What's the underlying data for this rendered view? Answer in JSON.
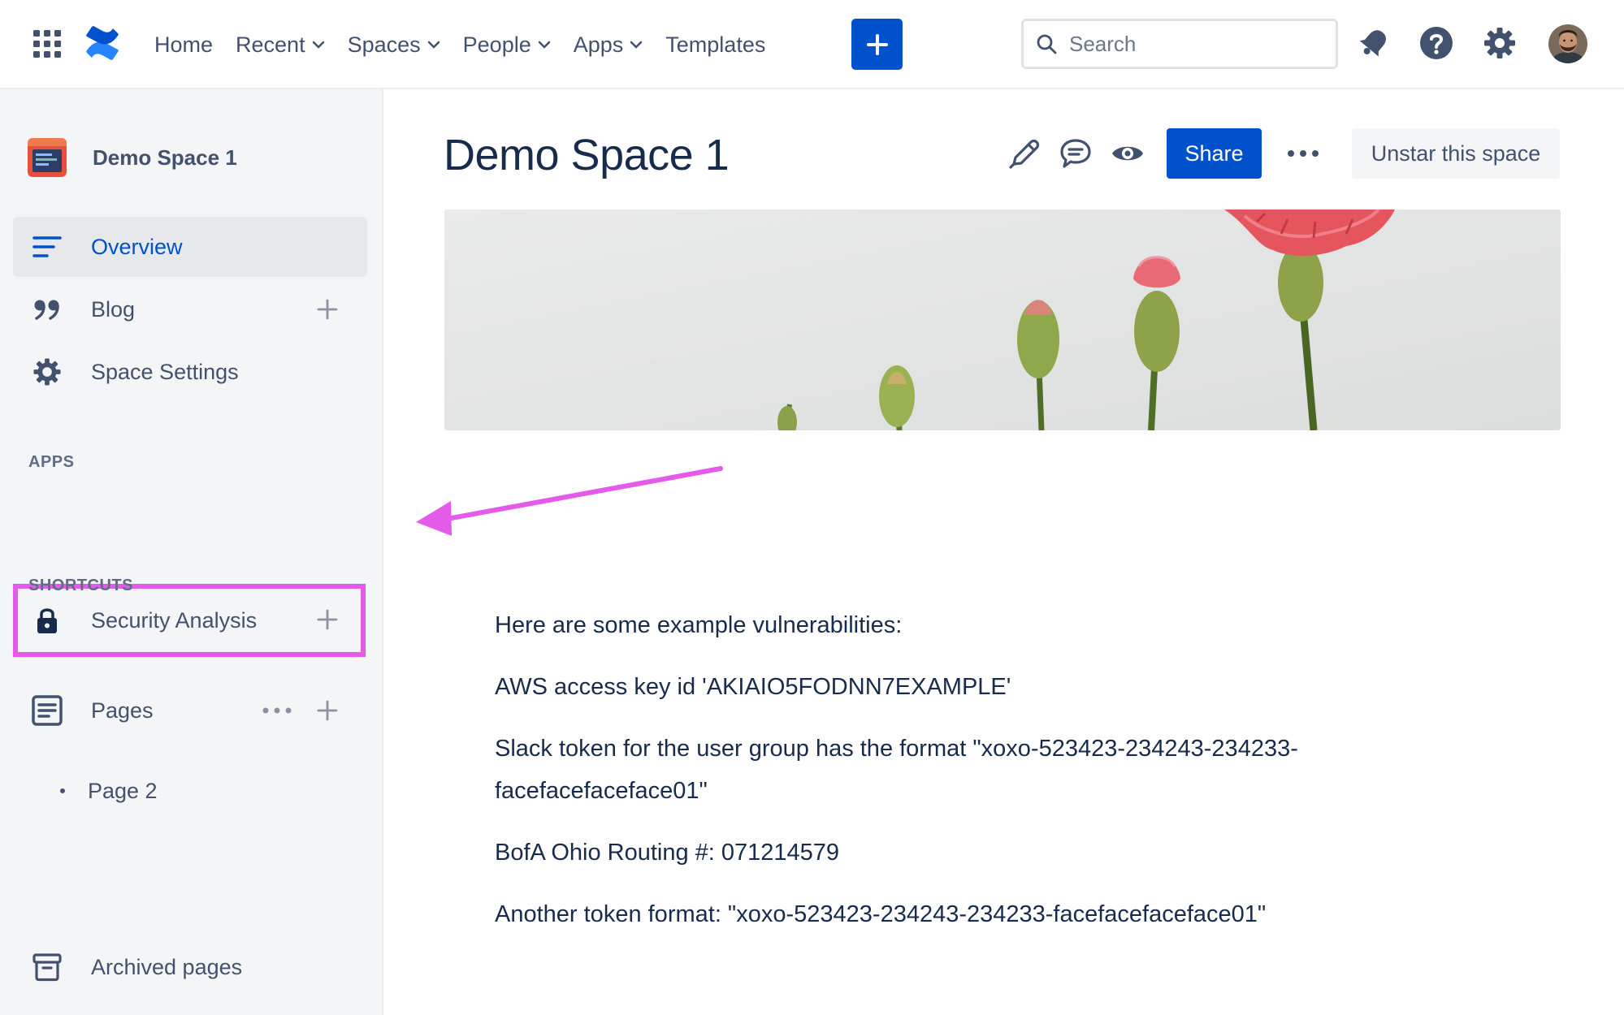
{
  "topnav": {
    "items": [
      {
        "label": "Home",
        "dropdown": false
      },
      {
        "label": "Recent",
        "dropdown": true
      },
      {
        "label": "Spaces",
        "dropdown": true
      },
      {
        "label": "People",
        "dropdown": true
      },
      {
        "label": "Apps",
        "dropdown": true
      },
      {
        "label": "Templates",
        "dropdown": false
      }
    ],
    "search_placeholder": "Search",
    "icons": [
      "app-switcher-icon",
      "confluence-logo",
      "plus-icon",
      "search-icon",
      "notification-icon",
      "help-icon",
      "settings-icon",
      "avatar"
    ]
  },
  "sidebar": {
    "space_name": "Demo Space 1",
    "items": [
      {
        "label": "Overview",
        "icon": "overview-icon",
        "active": true
      },
      {
        "label": "Blog",
        "icon": "quote-icon"
      },
      {
        "label": "Space Settings",
        "icon": "gear-icon"
      }
    ],
    "apps_title": "APPS",
    "apps": [
      {
        "label": "Security Analysis",
        "icon": "lock-icon"
      }
    ],
    "shortcuts_title": "SHORTCUTS",
    "pages_label": "Pages",
    "child_pages": [
      "Page 2"
    ],
    "archived_label": "Archived pages"
  },
  "main": {
    "title": "Demo Space 1",
    "share_label": "Share",
    "unstar_label": "Unstar this space",
    "paragraphs": [
      "Here are some example vulnerabilities:",
      "AWS access key id 'AKIAIO5FODNN7EXAMPLE'",
      "Slack token for the user group has the format \"xoxo-523423-234243-234233-facefacefaceface01\"",
      "BofA Ohio Routing #: 071214579",
      "Another token format: \"xoxo-523423-234243-234233-facefacefaceface01\""
    ]
  },
  "colors": {
    "primary": "#0052cc",
    "annotation": "#e45bea",
    "text": "#172b4d",
    "subtle_text": "#42526e",
    "sidebar_bg": "#f4f5f7"
  }
}
